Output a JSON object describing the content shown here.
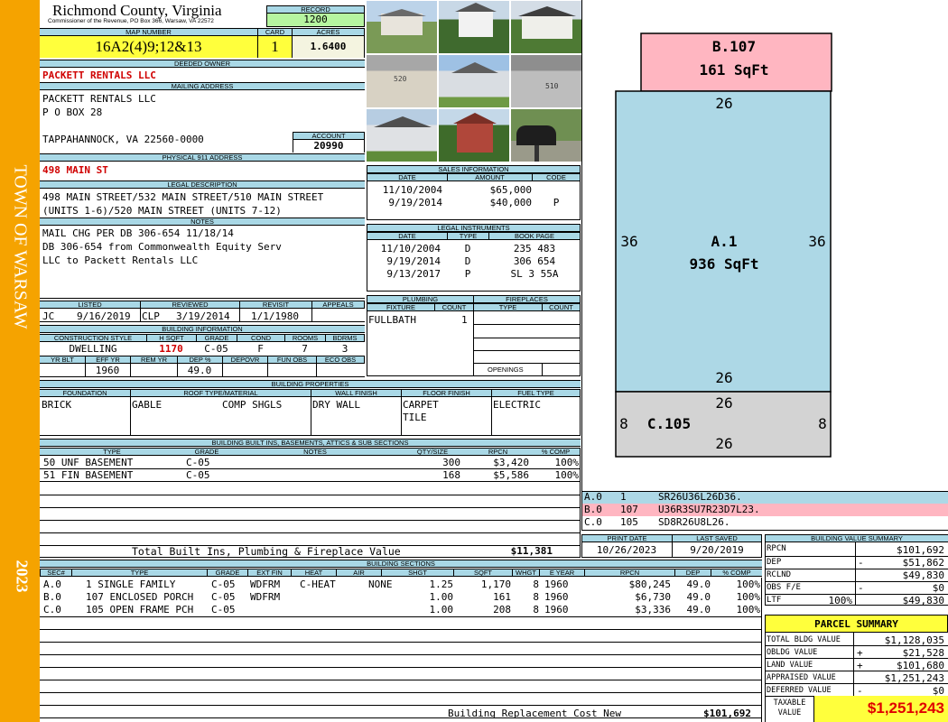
{
  "side": {
    "town": "TOWN OF WARSAW",
    "year": "2023"
  },
  "header": {
    "county": "Richmond County, Virginia",
    "commissioner": "Commissioner of the Revenue, PO Box 366, Warsaw, VA 22572",
    "record_label": "RECORD",
    "record": "1200",
    "map_label": "MAP NUMBER",
    "map_number": "16A2(4)9;12&13",
    "card_label": "CARD",
    "card": "1",
    "acres_label": "ACRES",
    "acres": "1.6400"
  },
  "owner": {
    "deeded_label": "DEEDED OWNER",
    "deeded_owner": "PACKETT RENTALS LLC",
    "mailing_label": "MAILING ADDRESS",
    "mail_line1": "PACKETT RENTALS LLC",
    "mail_line2": "P O BOX 28",
    "mail_line3": "TAPPAHANNOCK, VA 22560-0000",
    "account_label": "ACCOUNT",
    "account": "20990",
    "physical_label": "PHYSICAL 911 ADDRESS",
    "physical": "498 MAIN ST"
  },
  "legal": {
    "label": "LEGAL DESCRIPTION",
    "line1": "498 MAIN STREET/532 MAIN STREET/510 MAIN STREET",
    "line2": "(UNITS 1-6)/520 MAIN STREET (UNITS 7-12)"
  },
  "notes": {
    "label": "NOTES",
    "line1": "MAIL CHG PER DB 306-654 11/18/14",
    "line2": "DB 306-654 from Commonwealth Equity Serv",
    "line3": "LLC to Packett Rentals LLC"
  },
  "status": {
    "listed_label": "LISTED",
    "reviewed_label": "REVIEWED",
    "revisit_label": "REVISIT",
    "appeals_label": "APPEALS",
    "listed_by": "JC",
    "listed_date": "9/16/2019",
    "reviewed_by": "CLP",
    "reviewed_date": "3/19/2014",
    "revisit": "1/1/1980"
  },
  "building": {
    "label": "BUILDING INFORMATION",
    "h_style": "CONSTRUCTION STYLE",
    "h_sqft": "H SQFT",
    "h_grade": "GRADE",
    "h_cond": "COND",
    "h_rooms": "ROOMS",
    "h_bdrms": "BDRMS",
    "style": "DWELLING",
    "sqft": "1170",
    "grade": "C-05",
    "cond": "F",
    "rooms": "7",
    "bdrms": "3",
    "h_yrblt": "YR BLT",
    "h_effyr": "EFF YR",
    "h_remyr": "REM YR",
    "h_dep": "DEP %",
    "h_depovr": "DEPOVR",
    "h_funobs": "FUN OBS",
    "h_ecoobs": "ECO OBS",
    "effyr": "1960",
    "dep": "49.0"
  },
  "sales": {
    "label": "SALES INFORMATION",
    "h_date": "DATE",
    "h_amount": "AMOUNT",
    "h_code": "CODE",
    "rows": [
      {
        "date": "11/10/2004",
        "amount": "$65,000",
        "code": ""
      },
      {
        "date": "9/19/2014",
        "amount": "$40,000",
        "code": "P"
      }
    ]
  },
  "instruments": {
    "label": "LEGAL INSTRUMENTS",
    "h_date": "DATE",
    "h_type": "TYPE",
    "h_book": "BOOK PAGE",
    "rows": [
      {
        "date": "11/10/2004",
        "type": "D",
        "book": "235 483"
      },
      {
        "date": "9/19/2014",
        "type": "D",
        "book": "306 654"
      },
      {
        "date": "9/13/2017",
        "type": "P",
        "book": "SL 3 55A"
      }
    ]
  },
  "plumbing": {
    "label": "PLUMBING",
    "h_fixture": "FIXTURE",
    "h_count": "COUNT",
    "fixture": "FULLBATH",
    "count": "1"
  },
  "fireplaces": {
    "label": "FIREPLACES",
    "h_type": "TYPE",
    "h_count": "COUNT",
    "openings": "OPENINGS"
  },
  "properties": {
    "label": "BUILDING PROPERTIES",
    "h_foundation": "FOUNDATION",
    "h_roof": "ROOF TYPE/MATERIAL",
    "h_wall": "WALL FINISH",
    "h_floor": "FLOOR FINISH",
    "h_fuel": "FUEL TYPE",
    "foundation": "BRICK",
    "roof_type": "GABLE",
    "roof_material": "COMP SHGLS",
    "wall": "DRY WALL",
    "floor1": "CARPET",
    "floor2": "TILE",
    "fuel": "ELECTRIC"
  },
  "builtins": {
    "label": "BUILDING BUILT INS, BASEMENTS, ATTICS & SUB SECTIONS",
    "h_type": "TYPE",
    "h_grade": "GRADE",
    "h_notes": "NOTES",
    "h_qty": "QTY/SIZE",
    "h_rpcn": "RPCN",
    "h_comp": "% COMP",
    "rows": [
      {
        "type": "50 UNF BASEMENT",
        "grade": "C-05",
        "qty": "300",
        "rpcn": "$3,420",
        "comp": "100%"
      },
      {
        "type": "51 FIN BASEMENT",
        "grade": "C-05",
        "qty": "168",
        "rpcn": "$5,586",
        "comp": "100%"
      }
    ],
    "total_label": "Total Built Ins, Plumbing & Fireplace Value",
    "total": "$11,381"
  },
  "sections": {
    "label": "BUILDING SECTIONS",
    "h_sec": "SEC#",
    "h_type": "TYPE",
    "h_grade": "GRADE",
    "h_extfin": "EXT FIN",
    "h_heat": "HEAT",
    "h_air": "AIR",
    "h_shgt": "SHGT",
    "h_sqft": "SQFT",
    "h_whgt": "WHGT",
    "h_eyear": "E YEAR",
    "h_rpcn": "RPCN",
    "h_dep": "DEP",
    "h_comp": "% COMP",
    "rows": [
      {
        "sec": "A.0",
        "type": "1 SINGLE FAMILY",
        "grade": "C-05",
        "extfin": "WDFRM",
        "heat": "C-HEAT",
        "air": "NONE",
        "shgt": "1.25",
        "sqft": "1,170",
        "whgt": "8",
        "eyear": "1960",
        "rpcn": "$80,245",
        "dep": "49.0",
        "comp": "100%"
      },
      {
        "sec": "B.0",
        "type": "107 ENCLOSED PORCH",
        "grade": "C-05",
        "extfin": "WDFRM",
        "heat": "",
        "air": "",
        "shgt": "1.00",
        "sqft": "161",
        "whgt": "8",
        "eyear": "1960",
        "rpcn": "$6,730",
        "dep": "49.0",
        "comp": "100%"
      },
      {
        "sec": "C.0",
        "type": "105 OPEN FRAME PCH",
        "grade": "C-05",
        "extfin": "",
        "heat": "",
        "air": "",
        "shgt": "1.00",
        "sqft": "208",
        "whgt": "8",
        "eyear": "1960",
        "rpcn": "$3,336",
        "dep": "49.0",
        "comp": "100%"
      }
    ],
    "replacement_label": "Building Replacement Cost New",
    "replacement": "$101,692"
  },
  "sketch": {
    "b_name": "B.107",
    "b_area": "161 SqFt",
    "a_name": "A.1",
    "a_area": "936 SqFt",
    "c_name": "C.105",
    "dim_a_top": "26",
    "dim_a_left": "36",
    "dim_a_right": "36",
    "dim_a_bottom": "26",
    "dim_c_top": "26",
    "dim_c_left": "8",
    "dim_c_right": "8",
    "dim_c_bottom": "26",
    "colors": {
      "a": "#add8e6",
      "b": "#ffb6c1",
      "c": "#d3d3d3"
    }
  },
  "sketch_codes": [
    {
      "sec": "A.0",
      "code": "1",
      "path": "SR26U36L26D36."
    },
    {
      "sec": "B.0",
      "code": "107",
      "path": "U36R3SU7R23D7L23."
    },
    {
      "sec": "C.0",
      "code": "105",
      "path": "SD8R26U8L26."
    }
  ],
  "dates": {
    "print_label": "PRINT DATE",
    "print_date": "10/26/2023",
    "saved_label": "LAST SAVED",
    "last_saved": "9/20/2019"
  },
  "value_summary": {
    "label": "BUILDING VALUE SUMMARY",
    "rpcn_label": "RPCN",
    "rpcn": "$101,692",
    "dep_label": "DEP",
    "dep_sign": "-",
    "dep": "$51,862",
    "rclnd_label": "RCLND",
    "rclnd": "$49,830",
    "obs_label": "OBS F/E",
    "obs_sign": "-",
    "obs": "$0",
    "ltf_label": "LTF",
    "ltf_pct": "100%",
    "ltf": "$49,830"
  },
  "parcel": {
    "label": "PARCEL SUMMARY",
    "bldg_label": "TOTAL BLDG VALUE",
    "bldg": "$1,128,035",
    "obldg_label": "OBLDG VALUE",
    "obldg_sign": "+",
    "obldg": "$21,528",
    "land_label": "LAND VALUE",
    "land_sign": "+",
    "land": "$101,680",
    "appraised_label": "APPRAISED VALUE",
    "appraised": "$1,251,243",
    "deferred_label": "DEFERRED VALUE",
    "deferred_sign": "-",
    "deferred": "$0",
    "taxable_label1": "TAXABLE",
    "taxable_label2": "VALUE",
    "taxable": "$1,251,243"
  }
}
